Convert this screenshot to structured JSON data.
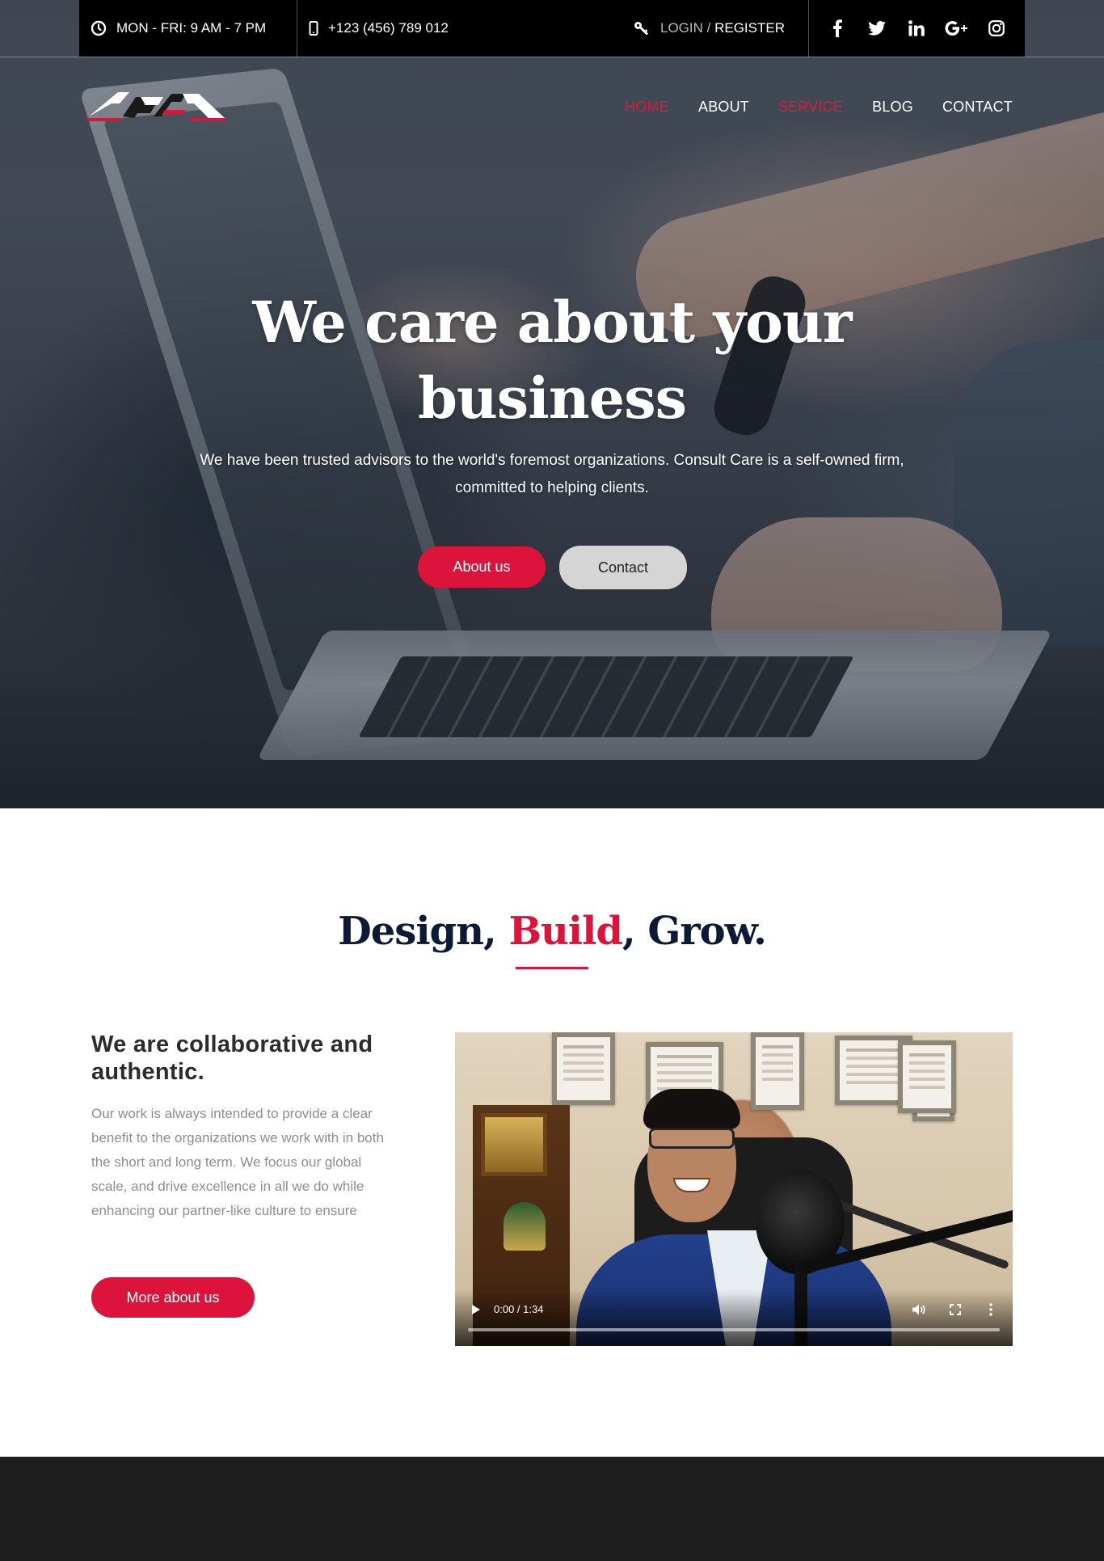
{
  "topbar": {
    "hours": "MON - FRI: 9 AM - 7 PM",
    "phone": "+123 (456) 789 012",
    "login": "LOGIN",
    "separator": " / ",
    "register": "REGISTER",
    "social": [
      "facebook-icon",
      "twitter-icon",
      "linkedin-icon",
      "google-plus-icon",
      "instagram-icon"
    ]
  },
  "nav": {
    "items": [
      {
        "label": "HOME",
        "active": true
      },
      {
        "label": "ABOUT",
        "active": false
      },
      {
        "label": "SERVICE",
        "active": true
      },
      {
        "label": "BLOG",
        "active": false
      },
      {
        "label": "CONTACT",
        "active": false
      }
    ]
  },
  "hero": {
    "title": "We care about your business",
    "subtitle": "We have been trusted advisors to the world's foremost organizations. Consult Care is a self-owned firm, committed to helping clients.",
    "button_primary": "About us",
    "button_secondary": "Contact"
  },
  "section": {
    "title_part1": "Design, ",
    "title_accent": "Build",
    "title_part2": ", Grow.",
    "heading": "We are collaborative and authentic.",
    "text": "Our work is always intended to provide a clear benefit to the organizations we work with in both the short and long term. We focus our global scale, and drive excellence in all we do while enhancing our partner-like culture to ensure",
    "button": "More about us"
  },
  "video": {
    "time": "0:00 / 1:34",
    "progress": 0
  },
  "colors": {
    "accent": "#dc143c",
    "navy": "#0c1a36",
    "topbar": "#000000",
    "footer": "#1e1e1e"
  }
}
